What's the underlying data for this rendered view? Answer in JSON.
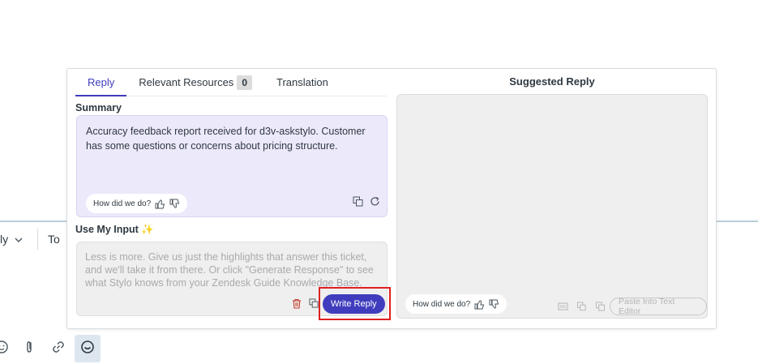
{
  "background": {
    "reply_label": "ly",
    "to_label": "To"
  },
  "tabs": [
    {
      "label": "Reply"
    },
    {
      "label": "Relevant Resources",
      "badge": "0"
    },
    {
      "label": "Translation"
    }
  ],
  "summary": {
    "label": "Summary",
    "text": "Accuracy feedback report received for d3v-askstylo. Customer has some questions or concerns about pricing structure.",
    "feedback_prompt": "How did we do?"
  },
  "user_input": {
    "label": "Use My Input ✨",
    "placeholder": "Less is more. Give us just the highlights that answer this ticket, and we'll take it from there. Or click \"Generate Response\" to see what Stylo knows from your Zendesk Guide Knowledge Base.",
    "write_reply_label": "Write Reply"
  },
  "suggested": {
    "title": "Suggested Reply",
    "feedback_prompt": "How did we do?",
    "paste_label": "Paste Into Text Editor"
  },
  "colors": {
    "accent": "#3f3dbd",
    "summary_bg": "#ece9fb",
    "highlight": "#e02020"
  }
}
